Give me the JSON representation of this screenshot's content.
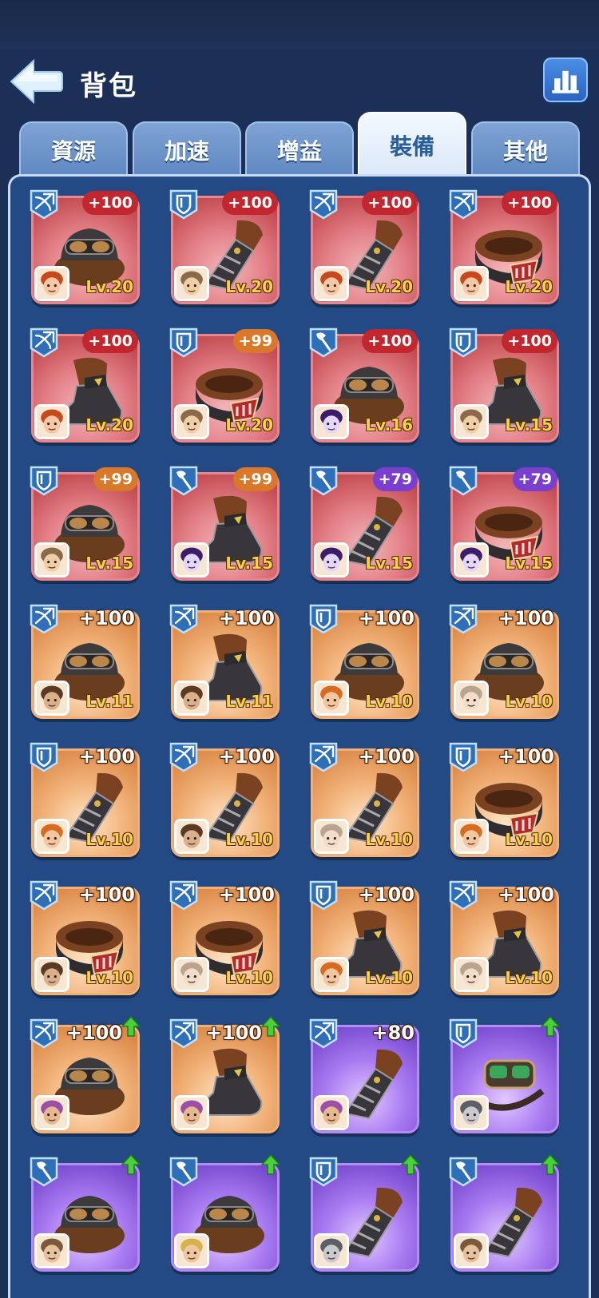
{
  "header": {
    "title": "背包"
  },
  "tabs": [
    {
      "label": "資源",
      "active": false
    },
    {
      "label": "加速",
      "active": false
    },
    {
      "label": "增益",
      "active": false
    },
    {
      "label": "裝備",
      "active": true
    },
    {
      "label": "其他",
      "active": false
    }
  ],
  "colors": {
    "red_rarity": "#c2262e",
    "orange_rarity": "#d9782a",
    "purple_rarity": "#7b3fd0",
    "level_text": "#f4d24b",
    "panel": "#234a84"
  },
  "items": [
    {
      "type": "crossbow",
      "bonus": "+100",
      "level": "Lv.20",
      "rarity": "red",
      "gear": "helmet",
      "hero": "red-haired-girl",
      "upgrade": false
    },
    {
      "type": "shield",
      "bonus": "+100",
      "level": "Lv.20",
      "rarity": "red",
      "gear": "gauntlet",
      "hero": "old-dwarf",
      "upgrade": false
    },
    {
      "type": "crossbow",
      "bonus": "+100",
      "level": "Lv.20",
      "rarity": "red",
      "gear": "gauntlet",
      "hero": "red-haired-girl",
      "upgrade": false
    },
    {
      "type": "crossbow",
      "bonus": "+100",
      "level": "Lv.20",
      "rarity": "red",
      "gear": "belt",
      "hero": "red-haired-girl",
      "upgrade": false
    },
    {
      "type": "crossbow",
      "bonus": "+100",
      "level": "Lv.20",
      "rarity": "red",
      "gear": "boot",
      "hero": "red-haired-girl",
      "upgrade": false
    },
    {
      "type": "shield",
      "bonus": "+99",
      "level": "Lv.20",
      "rarity": "red",
      "gear": "belt",
      "hero": "old-dwarf",
      "upgrade": false
    },
    {
      "type": "axe",
      "bonus": "+100",
      "level": "Lv.16",
      "rarity": "red",
      "gear": "helmet",
      "hero": "purple-hood",
      "upgrade": false
    },
    {
      "type": "shield",
      "bonus": "+100",
      "level": "Lv.15",
      "rarity": "red",
      "gear": "boot",
      "hero": "old-dwarf",
      "upgrade": false
    },
    {
      "type": "shield",
      "bonus": "+99",
      "level": "Lv.15",
      "rarity": "red",
      "gear": "helmet",
      "hero": "old-dwarf",
      "upgrade": false
    },
    {
      "type": "axe",
      "bonus": "+99",
      "level": "Lv.15",
      "rarity": "red",
      "gear": "boot",
      "hero": "purple-hood",
      "upgrade": false
    },
    {
      "type": "axe",
      "bonus": "+79",
      "level": "Lv.15",
      "rarity": "red",
      "gear": "gauntlet",
      "hero": "purple-hood",
      "upgrade": false
    },
    {
      "type": "axe",
      "bonus": "+79",
      "level": "Lv.15",
      "rarity": "red",
      "gear": "belt",
      "hero": "purple-hood",
      "upgrade": false
    },
    {
      "type": "crossbow",
      "bonus": "+100",
      "level": "Lv.11",
      "rarity": "orange",
      "gear": "helmet",
      "hero": "bald-man",
      "upgrade": false
    },
    {
      "type": "crossbow",
      "bonus": "+100",
      "level": "Lv.11",
      "rarity": "orange",
      "gear": "boot",
      "hero": "bald-man",
      "upgrade": false
    },
    {
      "type": "shield",
      "bonus": "+100",
      "level": "Lv.10",
      "rarity": "orange",
      "gear": "helmet",
      "hero": "viking",
      "upgrade": false
    },
    {
      "type": "crossbow",
      "bonus": "+100",
      "level": "Lv.10",
      "rarity": "orange",
      "gear": "helmet",
      "hero": "elder",
      "upgrade": false
    },
    {
      "type": "shield",
      "bonus": "+100",
      "level": "Lv.10",
      "rarity": "orange",
      "gear": "gauntlet",
      "hero": "viking",
      "upgrade": false
    },
    {
      "type": "crossbow",
      "bonus": "+100",
      "level": "Lv.10",
      "rarity": "orange",
      "gear": "gauntlet",
      "hero": "bald-man",
      "upgrade": false
    },
    {
      "type": "crossbow",
      "bonus": "+100",
      "level": "Lv.10",
      "rarity": "orange",
      "gear": "gauntlet",
      "hero": "elder",
      "upgrade": false
    },
    {
      "type": "shield",
      "bonus": "+100",
      "level": "Lv.10",
      "rarity": "orange",
      "gear": "belt",
      "hero": "viking",
      "upgrade": false
    },
    {
      "type": "crossbow",
      "bonus": "+100",
      "level": "Lv.10",
      "rarity": "orange",
      "gear": "belt",
      "hero": "bald-man",
      "upgrade": false
    },
    {
      "type": "crossbow",
      "bonus": "+100",
      "level": "Lv.10",
      "rarity": "orange",
      "gear": "belt",
      "hero": "elder",
      "upgrade": false
    },
    {
      "type": "shield",
      "bonus": "+100",
      "level": "Lv.10",
      "rarity": "orange",
      "gear": "boot",
      "hero": "viking",
      "upgrade": false
    },
    {
      "type": "crossbow",
      "bonus": "+100",
      "level": "Lv.10",
      "rarity": "orange",
      "gear": "boot",
      "hero": "elder",
      "upgrade": false
    },
    {
      "type": "crossbow",
      "bonus": "+100",
      "level": "",
      "rarity": "orange",
      "gear": "helmet",
      "hero": "turban-man",
      "upgrade": true
    },
    {
      "type": "crossbow",
      "bonus": "+100",
      "level": "",
      "rarity": "orange",
      "gear": "boot",
      "hero": "turban-man",
      "upgrade": true
    },
    {
      "type": "crossbow",
      "bonus": "+80",
      "level": "",
      "rarity": "purple",
      "gear": "gauntlet",
      "hero": "turban-man",
      "upgrade": false
    },
    {
      "type": "shield",
      "bonus": "",
      "level": "",
      "rarity": "purple",
      "gear": "goggles",
      "hero": "robot",
      "upgrade": true
    },
    {
      "type": "axe",
      "bonus": "",
      "level": "",
      "rarity": "purple",
      "gear": "helmet",
      "hero": "bearded-man",
      "upgrade": true
    },
    {
      "type": "axe",
      "bonus": "",
      "level": "",
      "rarity": "purple",
      "gear": "helmet",
      "hero": "blond-man",
      "upgrade": true
    },
    {
      "type": "shield",
      "bonus": "",
      "level": "",
      "rarity": "purple",
      "gear": "gauntlet",
      "hero": "robot",
      "upgrade": true
    },
    {
      "type": "axe",
      "bonus": "",
      "level": "",
      "rarity": "purple",
      "gear": "gauntlet",
      "hero": "bearded-man",
      "upgrade": true
    }
  ]
}
